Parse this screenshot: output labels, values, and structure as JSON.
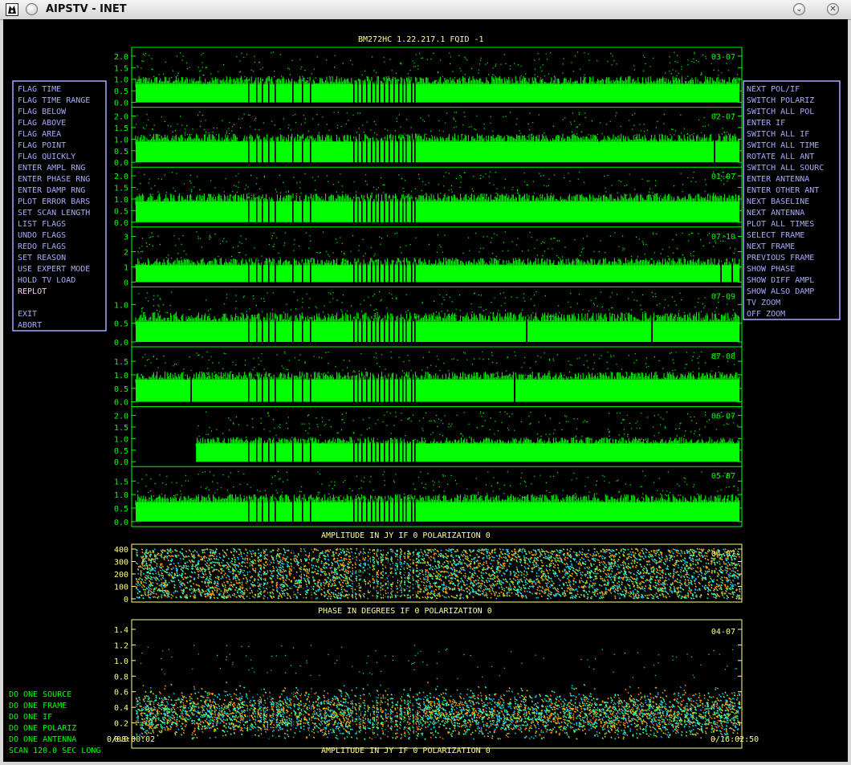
{
  "window": {
    "title": "AIPSTV - INET",
    "collapse_glyph": "⌄",
    "close_glyph": "✕"
  },
  "plot_title": "BM272HC 1.22.217.1   FQID -1",
  "menu_left": [
    "FLAG TIME",
    "FLAG TIME RANGE",
    "FLAG BELOW",
    "FLAG ABOVE",
    "FLAG AREA",
    "FLAG POINT",
    "FLAG QUICKLY",
    "ENTER AMPL RNG",
    "ENTER PHASE RNG",
    "ENTER DAMP RNG",
    "PLOT ERROR BARS",
    "SET SCAN LENGTH",
    "LIST FLAGS",
    "UNDO FLAGS",
    "REDO FLAGS",
    "SET REASON",
    "USE EXPERT MODE",
    "HOLD TV LOAD",
    "REPLOT",
    "",
    "EXIT",
    "ABORT"
  ],
  "menu_right": [
    "NEXT POL/IF",
    "SWITCH POLARIZ",
    "SWITCH ALL POL",
    "ENTER IF",
    "SWITCH ALL IF",
    "SWITCH ALL TIME",
    "ROTATE ALL ANT",
    "SWITCH ALL SOURC",
    "ENTER ANTENNA",
    "ENTER OTHER ANT",
    "NEXT BASELINE",
    "NEXT ANTENNA",
    "PLOT ALL TIMES",
    "SELECT FRAME",
    "NEXT FRAME",
    "PREVIOUS FRAME",
    "SHOW PHASE",
    "SHOW DIFF AMPL",
    "SHOW ALSO DAMP",
    "TV ZOOM",
    "OFF ZOOM"
  ],
  "bottom_menu": [
    "DO ONE SOURCE",
    "DO ONE FRAME",
    "DO ONE IF",
    "DO ONE POLARIZ",
    "DO ONE ANTENNA"
  ],
  "scan_text": "SCAN  120.0 SEC LONG",
  "time_start": "0/08:00:02",
  "time_end": "0/16:02:50",
  "upper_caption": "AMPLITUDE IN JY   IF  0    POLARIZATION 0",
  "phase_caption": "PHASE IN DEGREES   IF  0    POLARIZATION 0",
  "bottom_caption": "AMPLITUDE IN JY   IF  0    POLARIZATION 0",
  "colors": {
    "menu": "#a8a8ff",
    "panel": "#00ff00",
    "text": "#ffff80",
    "replot": "#ffc8ff",
    "bottom_menu": "#00ff00"
  },
  "chart_data": [
    {
      "type": "scatter",
      "x_range": [
        "0/08:00:02",
        "0/16:02:50"
      ],
      "panels": [
        {
          "baseline": "03-07",
          "ticks": [
            "2.0",
            "1.5",
            "1.0",
            "0.5",
            "0.0"
          ],
          "ylim": [
            0,
            2.1
          ],
          "base_level": 0.65,
          "noise": 0.35,
          "start_fraction": 0
        },
        {
          "baseline": "02-07",
          "ticks": [
            "2.0",
            "1.5",
            "1.0",
            "0.5",
            "0.0"
          ],
          "ylim": [
            0,
            2.1
          ],
          "base_level": 0.75,
          "noise": 0.35,
          "start_fraction": 0
        },
        {
          "baseline": "01-07",
          "ticks": [
            "2.0",
            "1.5",
            "1.0",
            "0.5",
            "0.0"
          ],
          "ylim": [
            0,
            2.1
          ],
          "base_level": 0.75,
          "noise": 0.35,
          "start_fraction": 0
        },
        {
          "baseline": "07-10",
          "ticks": [
            "3",
            "2",
            "1",
            "0"
          ],
          "ylim": [
            0,
            3.2
          ],
          "base_level": 0.9,
          "noise": 0.5,
          "start_fraction": 0
        },
        {
          "baseline": "07-09",
          "ticks": [
            "1.0",
            "0.5",
            "0.0"
          ],
          "ylim": [
            0,
            1.3
          ],
          "base_level": 0.45,
          "noise": 0.25,
          "start_fraction": 0
        },
        {
          "baseline": "07-08",
          "ticks": [
            "1.5",
            "1.0",
            "0.5",
            "0.0"
          ],
          "ylim": [
            0,
            1.8
          ],
          "base_level": 0.7,
          "noise": 0.3,
          "start_fraction": 0
        },
        {
          "baseline": "06-07",
          "ticks": [
            "2.0",
            "1.5",
            "1.0",
            "0.5",
            "0.0"
          ],
          "ylim": [
            0,
            2.1
          ],
          "base_level": 0.65,
          "noise": 0.3,
          "start_fraction": 0.1
        },
        {
          "baseline": "05-07",
          "ticks": [
            "1.5",
            "1.0",
            "0.5",
            "0.0"
          ],
          "ylim": [
            0,
            1.8
          ],
          "base_level": 0.6,
          "noise": 0.3,
          "start_fraction": 0
        }
      ]
    },
    {
      "type": "scatter",
      "baseline": "04-07",
      "ylabel": "PHASE IN DEGREES",
      "ticks": [
        "400",
        "300",
        "200",
        "100",
        "0"
      ],
      "ylim": [
        0,
        400
      ]
    },
    {
      "type": "scatter",
      "baseline": "04-07",
      "ylabel": "AMPLITUDE IN JY",
      "ticks": [
        "1.4",
        "1.2",
        "1.0",
        "0.8",
        "0.6",
        "0.4",
        "0.2",
        "0.0"
      ],
      "ylim": [
        0,
        1.4
      ]
    }
  ]
}
